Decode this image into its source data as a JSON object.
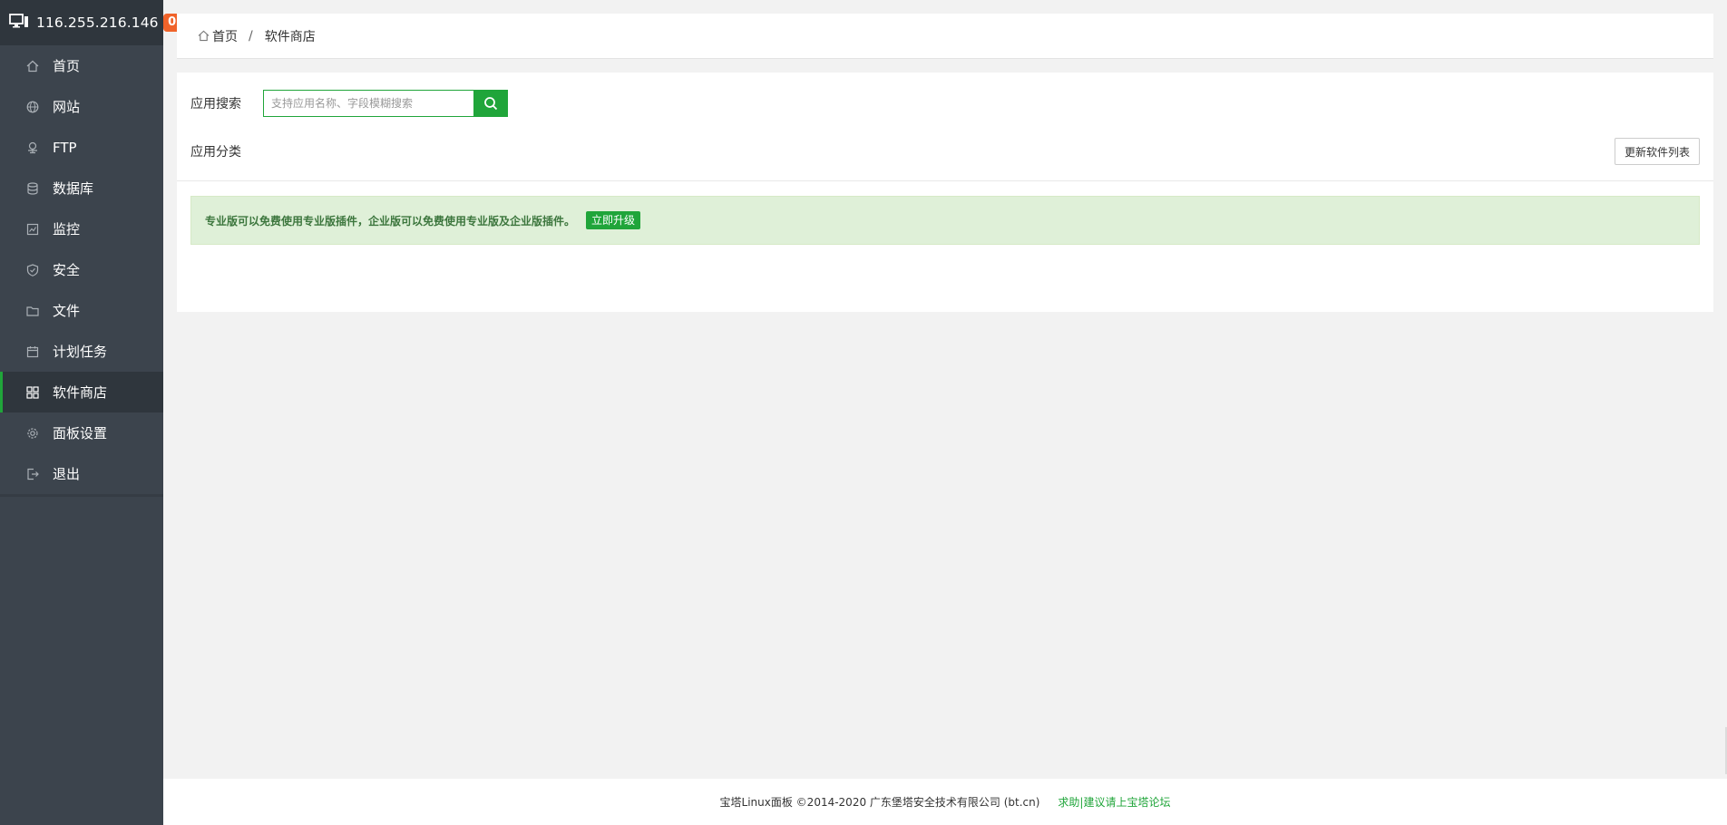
{
  "header": {
    "ip": "116.255.216.146",
    "badge": "0"
  },
  "menu": [
    {
      "label": "首页",
      "icon": "home-icon"
    },
    {
      "label": "网站",
      "icon": "globe-icon"
    },
    {
      "label": "FTP",
      "icon": "ftp-icon"
    },
    {
      "label": "数据库",
      "icon": "database-icon"
    },
    {
      "label": "监控",
      "icon": "monitor-icon"
    },
    {
      "label": "安全",
      "icon": "shield-icon"
    },
    {
      "label": "文件",
      "icon": "folder-icon"
    },
    {
      "label": "计划任务",
      "icon": "calendar-icon"
    },
    {
      "label": "软件商店",
      "icon": "grid-icon",
      "active": true
    },
    {
      "label": "面板设置",
      "icon": "gear-icon"
    },
    {
      "label": "退出",
      "icon": "logout-icon"
    }
  ],
  "breadcrumb": {
    "home": "首页",
    "separator": "/",
    "current": "软件商店"
  },
  "search": {
    "label": "应用搜索",
    "placeholder": "支持应用名称、字段模糊搜索",
    "value": ""
  },
  "category": {
    "label": "应用分类"
  },
  "update_button": "更新软件列表",
  "notice": {
    "text": "专业版可以免费使用专业版插件，企业版可以免费使用专业版及企业版插件。",
    "button": "立即升级"
  },
  "footer": {
    "copyright": "宝塔Linux面板 ©2014-2020 广东堡塔安全技术有限公司 (bt.cn)",
    "link": "求助|建议请上宝塔论坛"
  },
  "colors": {
    "accent": "#20a53a",
    "sidebar": "#3c444d",
    "badge": "#f0632a",
    "notice_bg": "#dff0d8"
  }
}
